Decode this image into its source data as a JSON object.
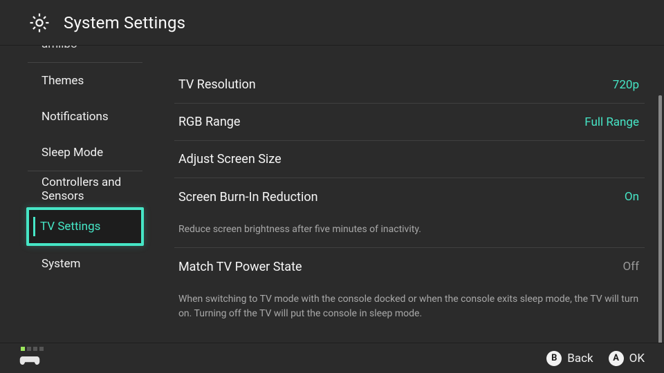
{
  "header": {
    "title": "System Settings"
  },
  "sidebar": {
    "partial_top": "amiibo",
    "group1": [
      "Themes",
      "Notifications",
      "Sleep Mode"
    ],
    "group2": [
      "Controllers and Sensors",
      "TV Settings",
      "System"
    ],
    "selected": "TV Settings"
  },
  "settings": {
    "tv_resolution": {
      "label": "TV Resolution",
      "value": "720p"
    },
    "rgb_range": {
      "label": "RGB Range",
      "value": "Full Range"
    },
    "adjust_screen_size": {
      "label": "Adjust Screen Size"
    },
    "burn_in": {
      "label": "Screen Burn-In Reduction",
      "value": "On",
      "desc": "Reduce screen brightness after five minutes of inactivity."
    },
    "match_power": {
      "label": "Match TV Power State",
      "value": "Off",
      "desc": "When switching to TV mode with the console docked or when the console exits sleep mode, the TV will turn on. Turning off the TV will put the console in sleep mode."
    }
  },
  "footer": {
    "back": {
      "glyph": "B",
      "label": "Back"
    },
    "ok": {
      "glyph": "A",
      "label": "OK"
    }
  },
  "colors": {
    "accent": "#46e6c6",
    "bg": "#2b2b2b"
  }
}
